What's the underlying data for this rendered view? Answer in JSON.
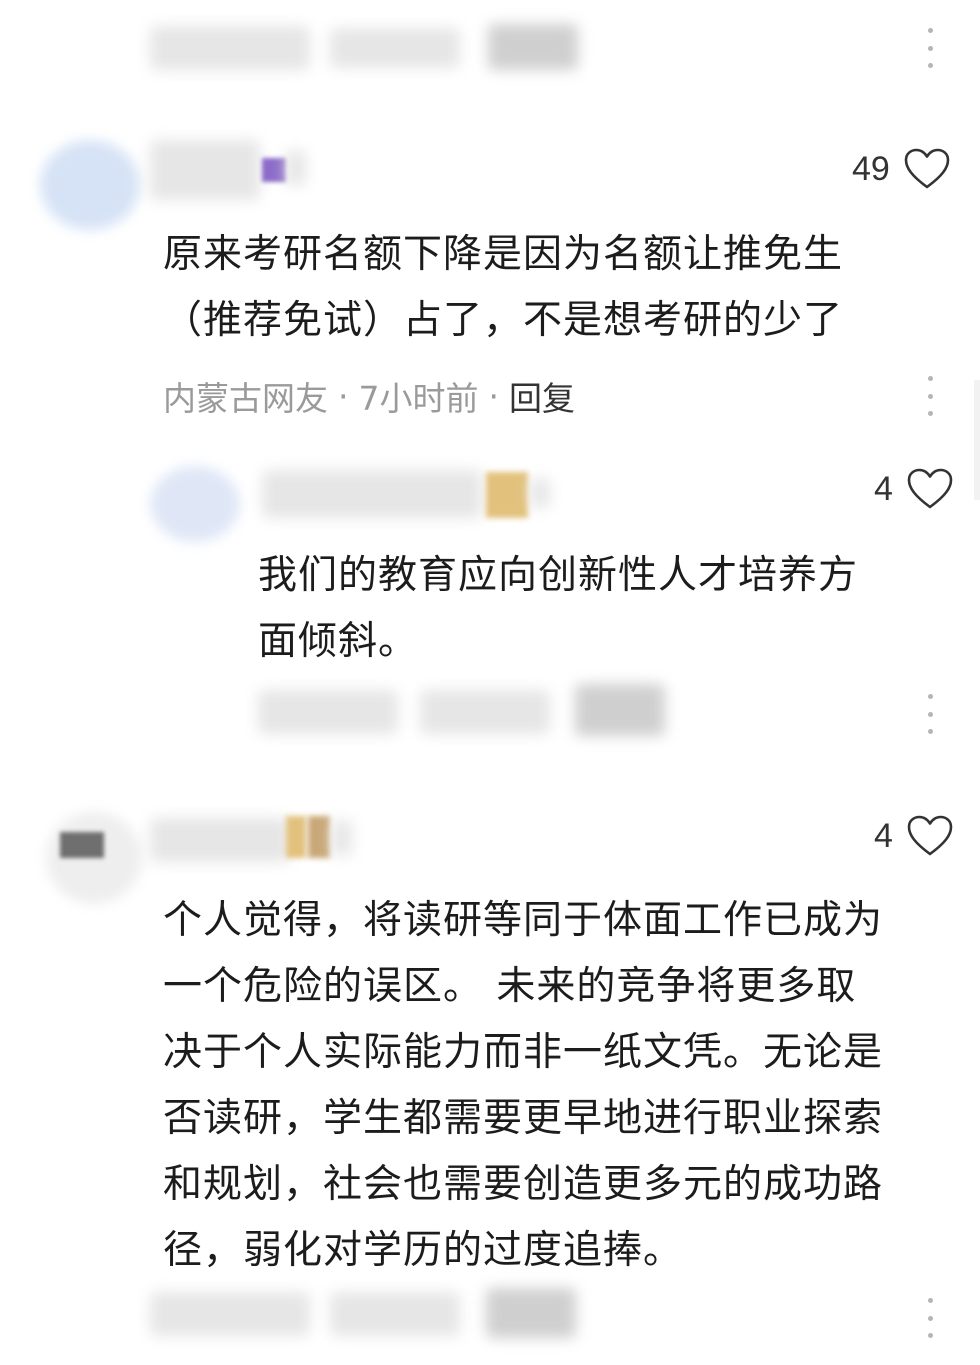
{
  "comments": [
    {
      "likes": "49",
      "text_lines": [
        "原来考研名额下降是因为名额让推免生",
        "（推荐免试）占了，不是想考研的少了"
      ],
      "location": "内蒙古网友",
      "time": "7小时前",
      "reply_label": "回复",
      "separator": "·",
      "replies": [
        {
          "likes": "4",
          "text_lines": [
            "我们的教育应向创新性人才培养方",
            "面倾斜。"
          ]
        }
      ]
    },
    {
      "likes": "4",
      "text_lines": [
        "个人觉得，将读研等同于体面工作已成为",
        "一个危险的误区。 未来的竞争将更多取",
        "决于个人实际能力而非一纸文凭。无论是",
        "否读研，学生都需要更早地进行职业探索",
        "和规划，社会也需要创造更多元的成功路",
        "径，弱化对学历的过度追捧。"
      ]
    }
  ],
  "icons": {
    "like": "heart-outline-icon",
    "more": "more-vertical-icon"
  },
  "colors": {
    "text": "#1c1c1c",
    "meta": "#9a9a9a",
    "heart_stroke": "#333333"
  }
}
